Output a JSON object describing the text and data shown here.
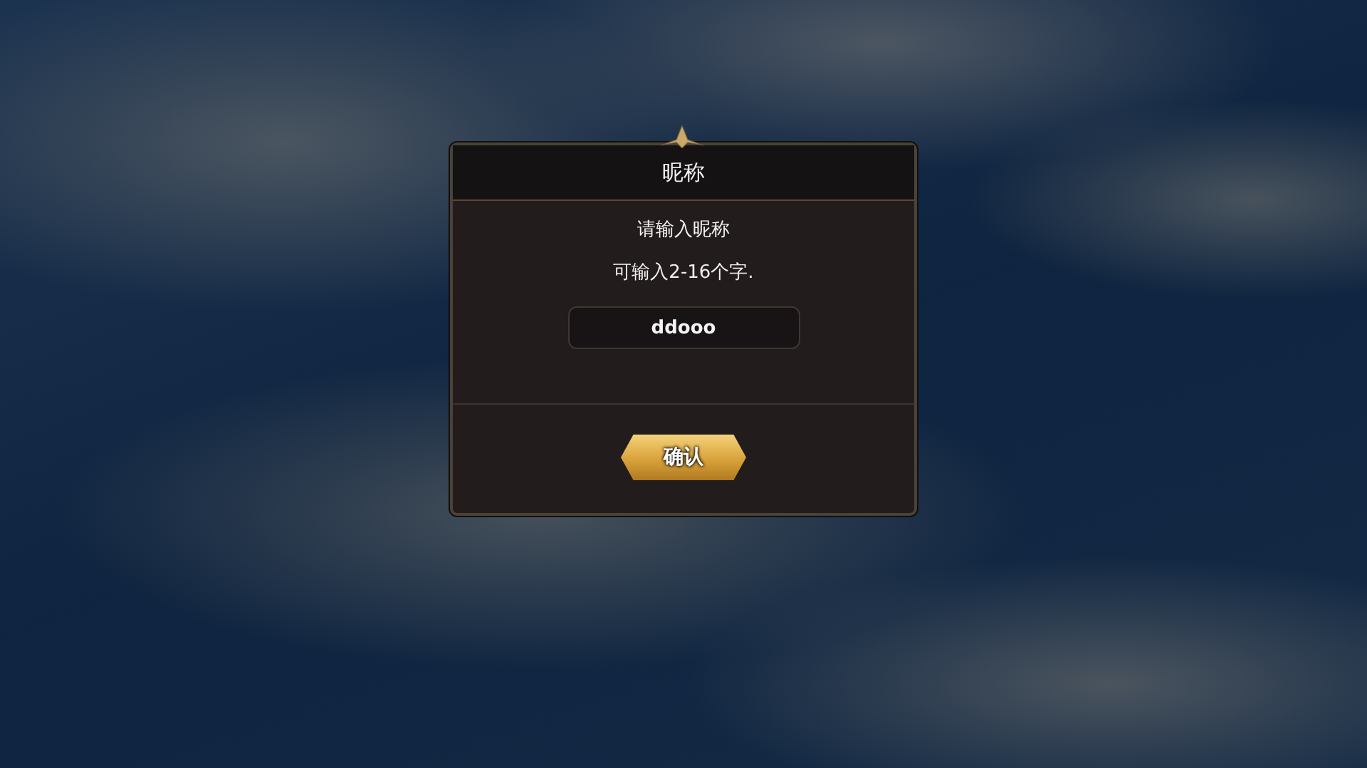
{
  "dialog": {
    "title": "昵称",
    "prompt": "请输入昵称",
    "hint": "可输入2-16个字.",
    "name_field": {
      "value": "ddooo"
    },
    "confirm_button": "确认"
  }
}
